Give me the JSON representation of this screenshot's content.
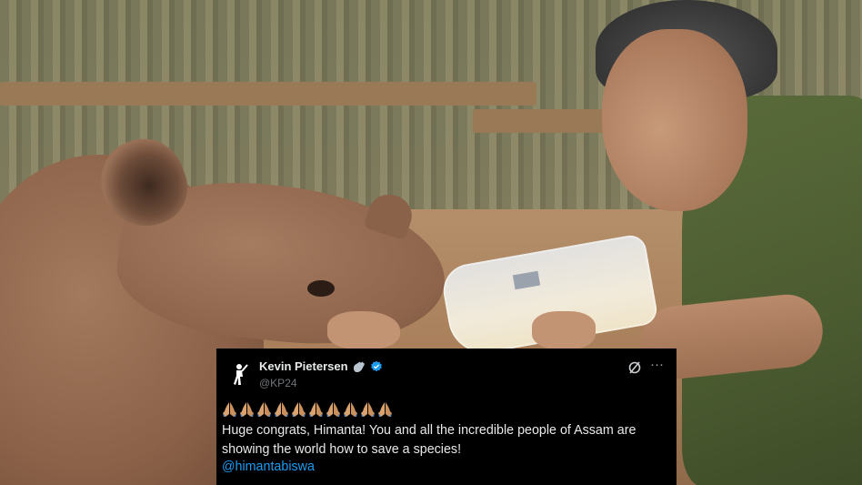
{
  "tweet": {
    "author_name": "Kevin Pietersen",
    "author_handle": "@KP24",
    "emoji_line_count": 10,
    "emoji_name": "folded-hands",
    "body_line1": "Huge congrats, Himanta! You and all the incredible people of Assam are",
    "body_line2": "showing the world how to save a species!",
    "mention": "@himantabiswa",
    "more_label": "···",
    "colors": {
      "background": "#000000",
      "text": "#e7e9ea",
      "handle": "#71767b",
      "link": "#1d9bf0",
      "verified": "#1d9bf0"
    }
  }
}
